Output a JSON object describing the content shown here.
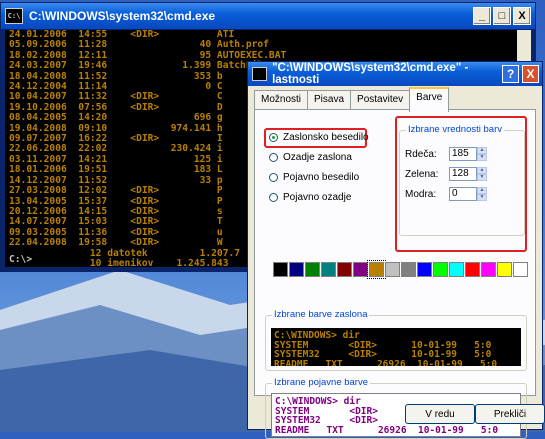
{
  "cmd": {
    "title": "C:\\WINDOWS\\system32\\cmd.exe",
    "icon_text": "C:\\",
    "minimize": "_",
    "maximize": "□",
    "close": "X",
    "lines": [
      "24.01.2006  14:55    <DIR>          ATI",
      "05.09.2006  11:28                40 Auth.prof",
      "18.02.2008  12:11                95 AUTOEXEC.BAT",
      "24.03.2007  19:46             1.399 BatchFile",
      "18.04.2008  11:52               353 b",
      "24.12.2004  11:14                 0 C",
      "10.04.2007  11:32    <DIR>          C",
      "19.10.2006  07:56    <DIR>          D",
      "08.04.2005  14:20               696 g",
      "19.04.2008  09:10           974.141 h",
      "09.07.2007  16:22    <DIR>          I",
      "22.06.2008  22:02           230.424 i",
      "03.11.2007  14:21               125 i",
      "18.01.2006  19:51               183 L",
      "14.12.2007  11:52                33 p",
      "27.03.2008  12:02    <DIR>          P",
      "13.04.2005  15:37    <DIR>          P",
      "20.12.2006  14:15    <DIR>          s",
      "14.07.2007  15:03    <DIR>          T",
      "09.03.2005  11:36    <DIR>          u",
      "22.04.2008  19:58    <DIR>          W",
      "              12 datotek         1.207.7",
      "              10 imenikov    1.245.843"
    ],
    "prompt": "C:\\>"
  },
  "dialog": {
    "title": "\"C:\\WINDOWS\\system32\\cmd.exe\" - lastnosti",
    "help": "?",
    "close": "X",
    "tabs": [
      "Možnosti",
      "Pisava",
      "Postavitev",
      "Barve"
    ],
    "radios": {
      "screen_text": "Zaslonsko besedilo",
      "screen_bg": "Ozadje zaslona",
      "popup_text": "Pojavno besedilo",
      "popup_bg": "Pojavno ozadje"
    },
    "color_group_label": "Izbrane vrednosti barv",
    "red_label": "Rdeča:",
    "red_value": "185",
    "green_label": "Zelena:",
    "green_value": "128",
    "blue_label": "Modra:",
    "blue_value": "0",
    "palette": [
      "#000000",
      "#000080",
      "#008000",
      "#008080",
      "#800000",
      "#800080",
      "#b98000",
      "#c0c0c0",
      "#808080",
      "#0000ff",
      "#00ff00",
      "#00ffff",
      "#ff0000",
      "#ff00ff",
      "#ffff00",
      "#ffffff"
    ],
    "screen_preview_label": "Izbrane barve zaslona",
    "screen_preview_lines": [
      "C:\\WINDOWS> dir",
      "SYSTEM       <DIR>      10-01-99   5:0",
      "SYSTEM32     <DIR>      10-01-99   5:0",
      "README   TXT      26926  10-01-99   5:0"
    ],
    "popup_preview_label": "Izbrane pojavne barve",
    "popup_preview_lines": [
      "C:\\WINDOWS> dir",
      "SYSTEM       <DIR>      10-01-99   5:0",
      "SYSTEM32     <DIR>      10-01-99   5:0",
      "README   TXT      26926  10-01-99   5:0"
    ],
    "ok": "V redu",
    "cancel": "Prekliči",
    "colors": {
      "screen_fg": "#b98000",
      "screen_bg": "#000000",
      "popup_fg": "#800080",
      "popup_bg": "#ffffff",
      "highlight": "#e02020"
    }
  }
}
